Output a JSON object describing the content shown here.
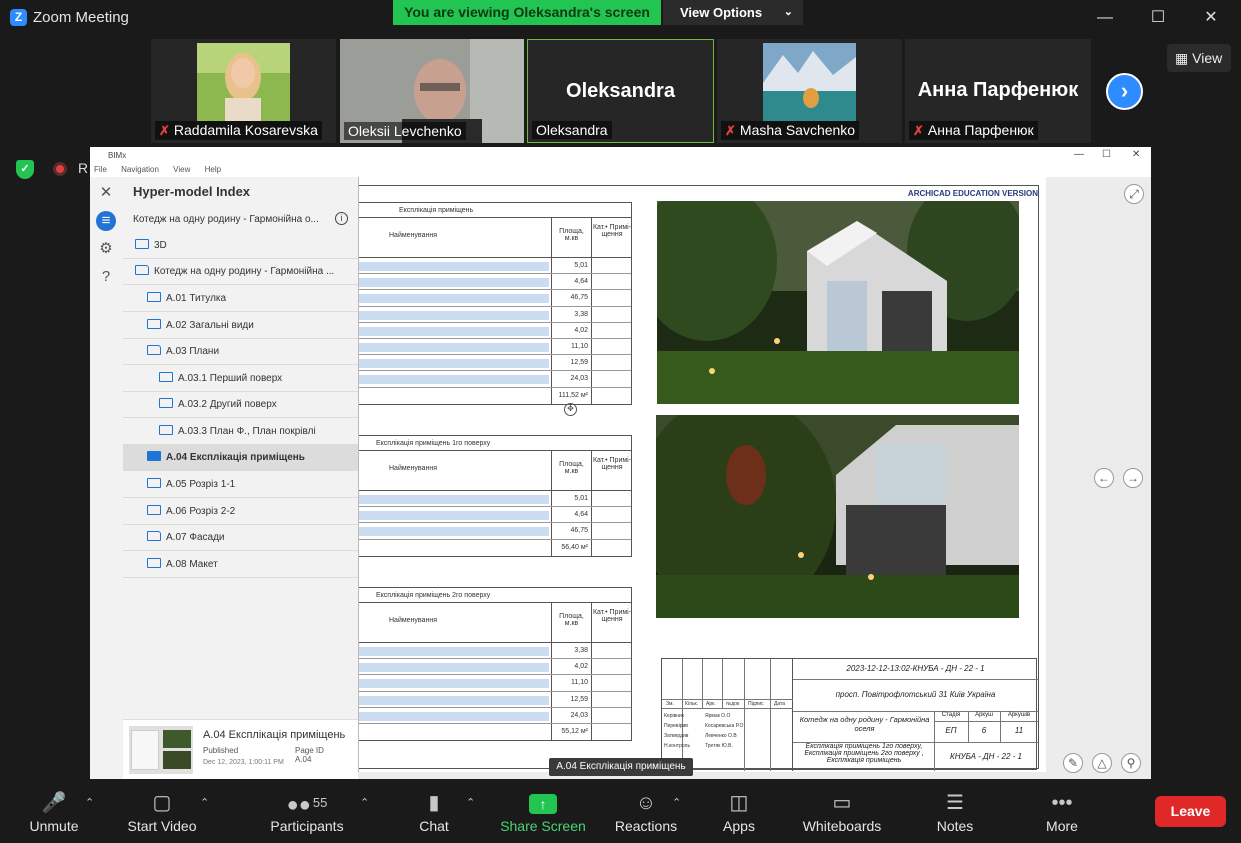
{
  "window": {
    "title": "Zoom Meeting"
  },
  "banner": {
    "text": "You are viewing Oleksandra's screen",
    "view_options": "View Options"
  },
  "participants": [
    {
      "name": "Raddamila Kosarevska",
      "muted": true
    },
    {
      "name": "Oleksii Levchenko",
      "muted": false
    },
    {
      "name": "Oleksandra",
      "display": "Oleksandra",
      "muted": false
    },
    {
      "name": "Masha Savchenko",
      "muted": true
    },
    {
      "name": "Анна Парфенюк",
      "display": "Анна Парфенюк",
      "muted": true
    }
  ],
  "view_button": "View",
  "recording_label": "R",
  "shared": {
    "app_title": "BIMx",
    "menu": [
      "File",
      "Navigation",
      "View",
      "Help"
    ],
    "panel_title": "Hyper-model Index",
    "breadcrumb": "Котедж на одну родину - Гармонійна о...",
    "tree": [
      {
        "label": "3D",
        "icon": "cube-icon"
      },
      {
        "label": "Котедж на одну родину - Гармонійна ...",
        "icon": "folder-icon"
      },
      {
        "label": "A.01 Титулка",
        "icon": "layout-icon"
      },
      {
        "label": "A.02 Загальні види",
        "icon": "layout-icon"
      },
      {
        "label": "A.03 Плани",
        "icon": "folder-icon"
      },
      {
        "label": "A.03.1 Перший поверх",
        "icon": "layout-icon"
      },
      {
        "label": "A.03.2 Другий поверх",
        "icon": "layout-icon"
      },
      {
        "label": "A.03.3 План Ф., План покрівлі",
        "icon": "layout-icon"
      },
      {
        "label": "A.04 Експлікація приміщень",
        "icon": "layout-icon",
        "selected": true
      },
      {
        "label": "A.05 Розріз 1-1",
        "icon": "layout-icon"
      },
      {
        "label": "A.06 Розріз 2-2",
        "icon": "layout-icon"
      },
      {
        "label": "A.07 Фасади",
        "icon": "folder-icon"
      },
      {
        "label": "A.08 Макет",
        "icon": "layout-icon"
      }
    ],
    "thumb": {
      "title": "A.04 Експлікація приміщень",
      "status": "Published",
      "page_id_label": "Page ID",
      "page_id": "A.04",
      "date": "Dec 12, 2023, 1:00:11 PM"
    },
    "tooltip": "A.04 Експлікація приміщень",
    "sheet": {
      "watermark": "ARCHICAD EDUCATION VERSION",
      "col_name": "Найменування",
      "col_area": "Площа, м.кв",
      "col_cat": "Кат.• Примі- щення",
      "tables": [
        {
          "title": "Експлікація приміщень",
          "values": [
            "5,01",
            "4,64",
            "46,75",
            "3,38",
            "4,02",
            "11,10",
            "12,59",
            "24,03"
          ],
          "total": "111,52 м²"
        },
        {
          "title": "Експлікація приміщень 1го поверху",
          "values": [
            "5,01",
            "4,64",
            "46,75"
          ],
          "total": "56,40 м²"
        },
        {
          "title": "Експлікація приміщень 2го поверху",
          "values": [
            "3,38",
            "4,02",
            "11,10",
            "12,59",
            "24,03"
          ],
          "total": "55,12 м²"
        }
      ],
      "titleblock": {
        "code": "2023-12-12-13:02-КНУБА - ДН - 22 - 1",
        "address": "просп. Повітрофлотський 31 Київ Україна",
        "project": "Котедж на одну родину - Гармонійна оселя",
        "sheet_desc": "Експлікація приміщень 1го поверху, Експлікація приміщень 2го поверху , Експлікація приміщень",
        "stage_h": "Стадія",
        "sheet_h": "Аркуш",
        "sheets_h": "Аркушів",
        "stage": "ЕП",
        "sheet": "6",
        "sheets": "11",
        "org": "КНУБА - ДН - 22 - 1",
        "hdr_cells": [
          "Зм.",
          "Кільк.",
          "Арк.",
          "№док",
          "Підпис",
          "Дата"
        ],
        "people": [
          "Керівник",
          "Перевірив",
          "Затвердив",
          "Н.контроль"
        ],
        "names": [
          "Ярмак О.О",
          "Косаревська Р.О",
          "Левченко О.В",
          "Третяк Ю.В."
        ]
      }
    }
  },
  "toolbar": {
    "unmute": "Unmute",
    "start_video": "Start Video",
    "participants": "Participants",
    "participants_count": "55",
    "chat": "Chat",
    "share_screen": "Share Screen",
    "reactions": "Reactions",
    "apps": "Apps",
    "whiteboards": "Whiteboards",
    "notes": "Notes",
    "more": "More",
    "leave": "Leave"
  }
}
